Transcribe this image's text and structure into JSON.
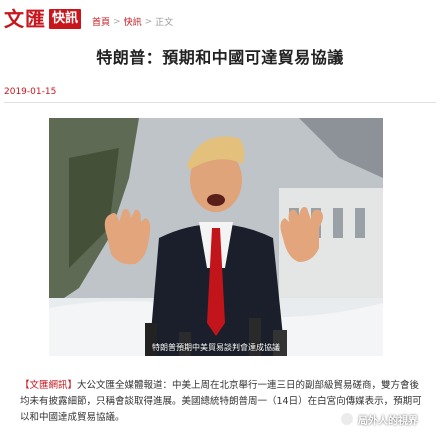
{
  "header": {
    "logo_text": "文匯",
    "logo_badge": "快訊",
    "breadcrumb": [
      {
        "label": "首頁"
      },
      {
        "label": "快訊"
      },
      {
        "label": "正文"
      }
    ],
    "separator": ">"
  },
  "article": {
    "title": "特朗普：預期和中國可達貿易協議",
    "date": "2019-01-15",
    "photo_caption": "特朗普預期中美貿易談判會達成協議",
    "source_tag": "【文匯網訊】",
    "body": "大公文匯全媒體報道：中美上周在北京舉行一連三日的副部級貿易磋商，雙方會後均未有披露細節，只稱會談取得進展。美國總統特朗普周一（14日）在白宮向傳媒表示，預期可以和中國達成貿易協議。"
  },
  "watermark": {
    "text": "局外人的視界"
  },
  "colors": {
    "brand_red": "#c8161d"
  }
}
